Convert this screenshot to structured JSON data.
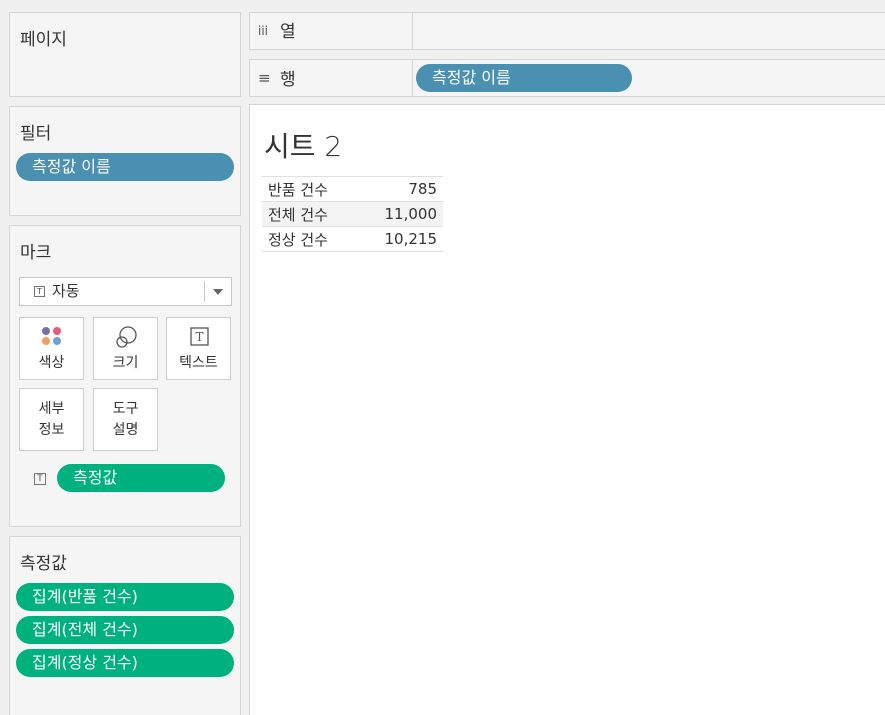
{
  "pages_card": {
    "title": "페이지"
  },
  "filters_card": {
    "title": "필터",
    "pills": [
      "측정값 이름"
    ]
  },
  "marks_card": {
    "title": "마크",
    "mark_type": "자동",
    "buttons": {
      "color": "색상",
      "size": "크기",
      "text": "텍스트",
      "detail_line1": "세부",
      "detail_line2": "정보",
      "tooltip_line1": "도구",
      "tooltip_line2": "설명"
    },
    "text_field": "측정값",
    "color_dots": [
      "#7b6ea6",
      "#e45f76",
      "#f0a35e",
      "#6d9fd9"
    ]
  },
  "measures_card": {
    "title": "측정값",
    "pills": [
      "집계(반품 건수)",
      "집계(전체 건수)",
      "집계(정상 건수)"
    ]
  },
  "shelves": {
    "columns": {
      "icon": "iii",
      "label": "열"
    },
    "rows": {
      "icon": "≡",
      "label": "행",
      "pill": "측정값 이름"
    }
  },
  "view": {
    "title": "시트 2",
    "rows": [
      {
        "name": "반품 건수",
        "value": "785"
      },
      {
        "name": "전체 건수",
        "value": "11,000"
      },
      {
        "name": "정상 건수",
        "value": "10,215"
      }
    ]
  },
  "colors": {
    "dimension_pill": "#4a90b0",
    "measure_pill": "#00b180"
  }
}
